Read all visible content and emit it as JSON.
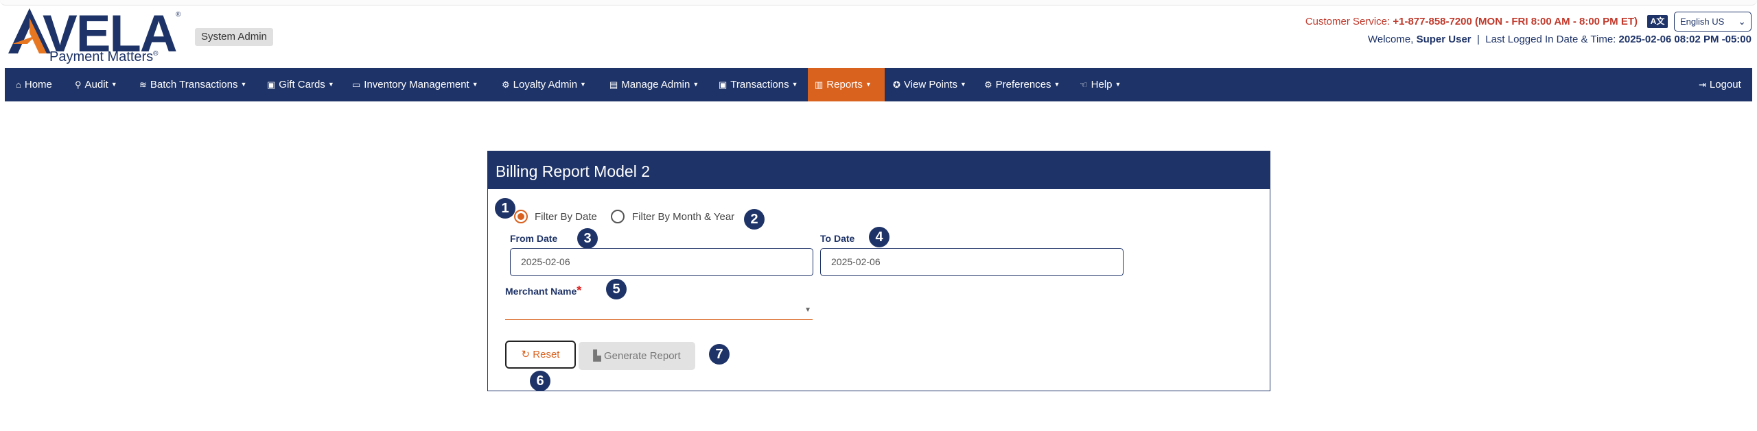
{
  "header": {
    "logo_word": "VELA",
    "logo_tagline": "Payment Matters",
    "logo_reg": "®",
    "role_badge": "System Admin",
    "customer_service_label": "Customer Service:",
    "customer_service_value": "+1-877-858-7200 (MON - FRI 8:00 AM - 8:00 PM ET)",
    "language_icon": "translate-icon",
    "language_selected": "English US",
    "welcome_label": "Welcome,",
    "welcome_user": "Super User",
    "separator": "|",
    "last_login_label": "Last Logged In Date & Time:",
    "last_login_value": "2025-02-06 08:02 PM -05:00"
  },
  "nav": {
    "items": [
      {
        "label": "Home",
        "icon": "home-icon",
        "glyph": "⌂",
        "caret": false
      },
      {
        "label": "Audit",
        "icon": "search-icon",
        "glyph": "⚲",
        "caret": true
      },
      {
        "label": "Batch Transactions",
        "icon": "layers-icon",
        "glyph": "≋",
        "caret": true
      },
      {
        "label": "Gift Cards",
        "icon": "gift-icon",
        "glyph": "▣",
        "caret": true
      },
      {
        "label": "Inventory Management",
        "icon": "box-icon",
        "glyph": "▭",
        "caret": true
      },
      {
        "label": "Loyalty Admin",
        "icon": "cogs-icon",
        "glyph": "⚙",
        "caret": true
      },
      {
        "label": "Manage Admin",
        "icon": "briefcase-icon",
        "glyph": "▤",
        "caret": true
      },
      {
        "label": "Transactions",
        "icon": "money-icon",
        "glyph": "▣",
        "caret": true
      },
      {
        "label": "Reports",
        "icon": "bar-chart-icon",
        "glyph": "▥",
        "caret": true,
        "active": true
      },
      {
        "label": "View Points",
        "icon": "award-icon",
        "glyph": "✪",
        "caret": true
      },
      {
        "label": "Preferences",
        "icon": "gear-icon",
        "glyph": "⚙",
        "caret": true
      },
      {
        "label": "Help",
        "icon": "hand-icon",
        "glyph": "☜",
        "caret": true
      }
    ],
    "logout": {
      "label": "Logout",
      "icon": "logout-icon",
      "glyph": "⇥"
    }
  },
  "form": {
    "title": "Billing Report Model 2",
    "radio_date": "Filter By Date",
    "radio_month": "Filter By Month & Year",
    "filter_selected": "date",
    "from_label": "From Date",
    "from_value": "2025-02-06",
    "to_label": "To Date",
    "to_value": "2025-02-06",
    "merchant_label": "Merchant Name",
    "merchant_required": "*",
    "merchant_value": "",
    "reset_label": "Reset",
    "generate_label": "Generate Report"
  },
  "markers": [
    "1",
    "2",
    "3",
    "4",
    "5",
    "6",
    "7"
  ],
  "colors": {
    "brand_navy": "#1e3367",
    "accent_orange": "#d9621f",
    "customer_service_red": "#c0392b"
  }
}
